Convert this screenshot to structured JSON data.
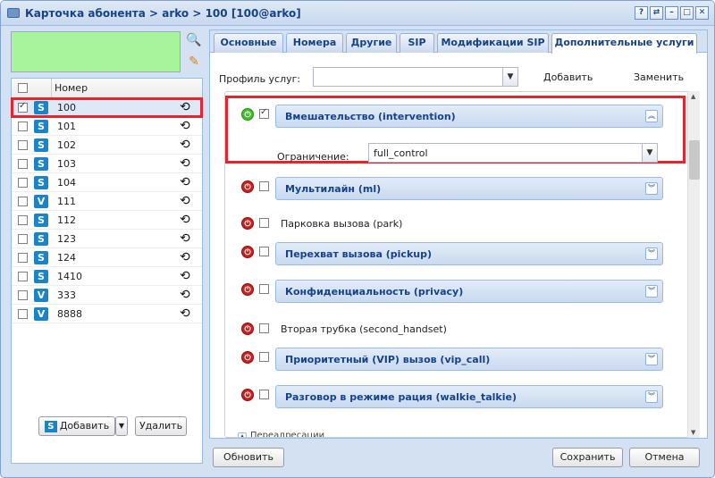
{
  "window": {
    "title": "Карточка абонента > arko > 100 [100@arko]",
    "buttons": [
      "?",
      "⇄",
      "–",
      "□",
      "✕"
    ]
  },
  "subscriber_list": {
    "column_header": "Номер",
    "rows": [
      {
        "number": "100",
        "type": "S",
        "checked": true
      },
      {
        "number": "101",
        "type": "S",
        "checked": false
      },
      {
        "number": "102",
        "type": "S",
        "checked": false
      },
      {
        "number": "103",
        "type": "S",
        "checked": false
      },
      {
        "number": "104",
        "type": "S",
        "checked": false
      },
      {
        "number": "111",
        "type": "V",
        "checked": false
      },
      {
        "number": "112",
        "type": "S",
        "checked": false
      },
      {
        "number": "123",
        "type": "S",
        "checked": false
      },
      {
        "number": "124",
        "type": "S",
        "checked": false
      },
      {
        "number": "1410",
        "type": "S",
        "checked": false
      },
      {
        "number": "333",
        "type": "V",
        "checked": false
      },
      {
        "number": "8888",
        "type": "V",
        "checked": false
      }
    ],
    "add_label": "Добавить",
    "delete_label": "Удалить"
  },
  "tabs": [
    "Основные",
    "Номера",
    "Другие",
    "SIP",
    "Модификации SIP",
    "Дополнительные услуги"
  ],
  "active_tab": "Дополнительные услуги",
  "profile": {
    "label": "Профиль услуг:",
    "value": "",
    "add_label": "Добавить",
    "replace_label": "Заменить"
  },
  "services": [
    {
      "title": "Вмешательство (intervention)",
      "enabled": true,
      "checked": true,
      "panel": true,
      "expanded": true
    },
    {
      "title": "Мультилайн (ml)",
      "enabled": false,
      "checked": false,
      "panel": true
    },
    {
      "title": "Парковка вызова (park)",
      "enabled": false,
      "checked": false,
      "panel": false
    },
    {
      "title": "Перехват вызова (pickup)",
      "enabled": false,
      "checked": false,
      "panel": true
    },
    {
      "title": "Конфиденциальность (privacy)",
      "enabled": false,
      "checked": false,
      "panel": true
    },
    {
      "title": "Вторая трубка (second_handset)",
      "enabled": false,
      "checked": false,
      "panel": false
    },
    {
      "title": "Приоритетный (VIP) вызов (vip_call)",
      "enabled": false,
      "checked": false,
      "panel": true
    },
    {
      "title": "Разговор в режиме рация (walkie_talkie)",
      "enabled": false,
      "checked": false,
      "panel": true
    }
  ],
  "intervention": {
    "limit_label": "Ограничение:",
    "limit_value": "full_control"
  },
  "bottom_section": "Переадресации",
  "footer": {
    "refresh_label": "Обновить",
    "save_label": "Сохранить",
    "cancel_label": "Отмена"
  },
  "colors": {
    "accent": "#15428b",
    "highlight": "#e3262d",
    "filter_bg": "#a6f59a"
  }
}
